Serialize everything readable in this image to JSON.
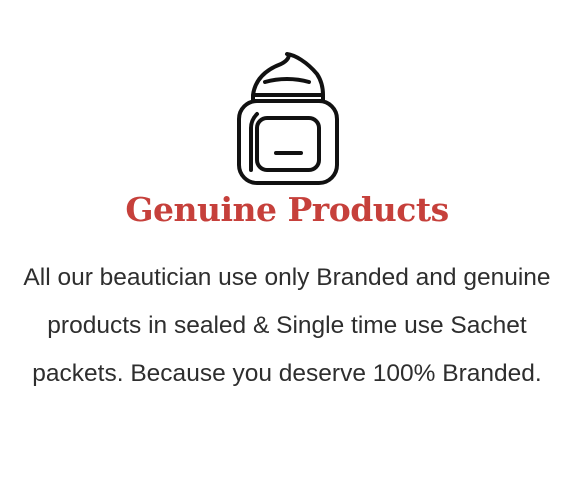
{
  "card": {
    "icon": "cream-jar-icon",
    "title": "Genuine Products",
    "description": "All our beautician use only Branded and genuine products in sealed & Single time use Sachet packets. Because you deserve 100% Branded."
  },
  "colors": {
    "title": "#c6403b",
    "text": "#2e2e2e",
    "icon_stroke": "#111111",
    "background": "#ffffff"
  }
}
